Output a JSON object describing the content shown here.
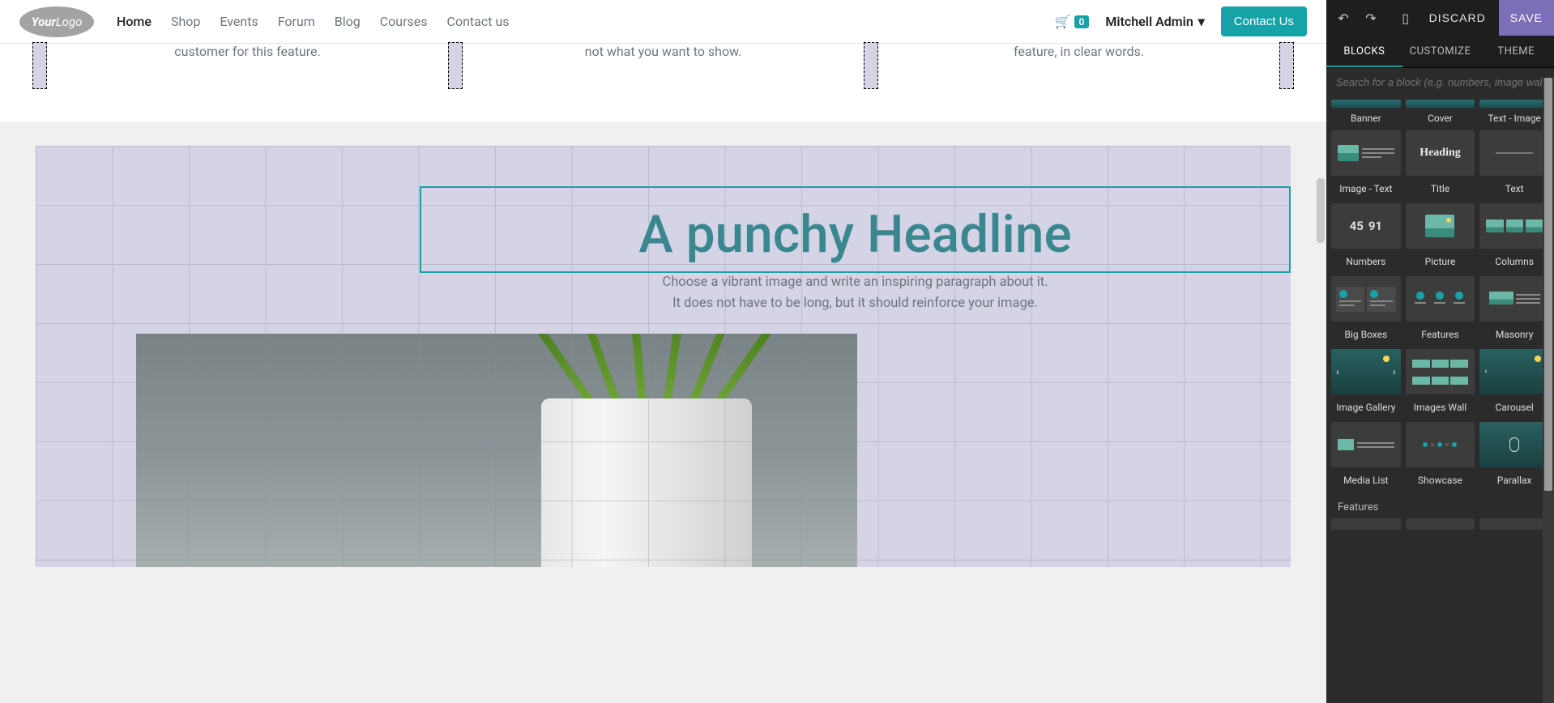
{
  "navbar": {
    "logo_a": "Your",
    "logo_b": "Logo",
    "links": [
      "Home",
      "Shop",
      "Events",
      "Forum",
      "Blog",
      "Courses",
      "Contact us"
    ],
    "active_index": 0,
    "cart_count": "0",
    "user": "Mitchell Admin",
    "contact_btn": "Contact Us"
  },
  "features": {
    "col1": "customer for this feature.",
    "col2": "not what you want to show.",
    "col3": "feature, in clear words."
  },
  "cover": {
    "headline": "A punchy Headline",
    "sub1": "Choose a vibrant image and write an inspiring paragraph about it.",
    "sub2": "It does not have to be long, but it should reinforce your image."
  },
  "sidebar": {
    "discard": "DISCARD",
    "save": "SAVE",
    "tabs": [
      "BLOCKS",
      "CUSTOMIZE",
      "THEME"
    ],
    "active_tab": 0,
    "search_placeholder": "Search for a block (e.g. numbers, image wall, ...)",
    "row0": [
      "Banner",
      "Cover",
      "Text - Image"
    ],
    "blocks": [
      "Image - Text",
      "Title",
      "Text",
      "Numbers",
      "Picture",
      "Columns",
      "Big Boxes",
      "Features",
      "Masonry",
      "Image Gallery",
      "Images Wall",
      "Carousel",
      "Media List",
      "Showcase",
      "Parallax"
    ],
    "section2": "Features"
  }
}
